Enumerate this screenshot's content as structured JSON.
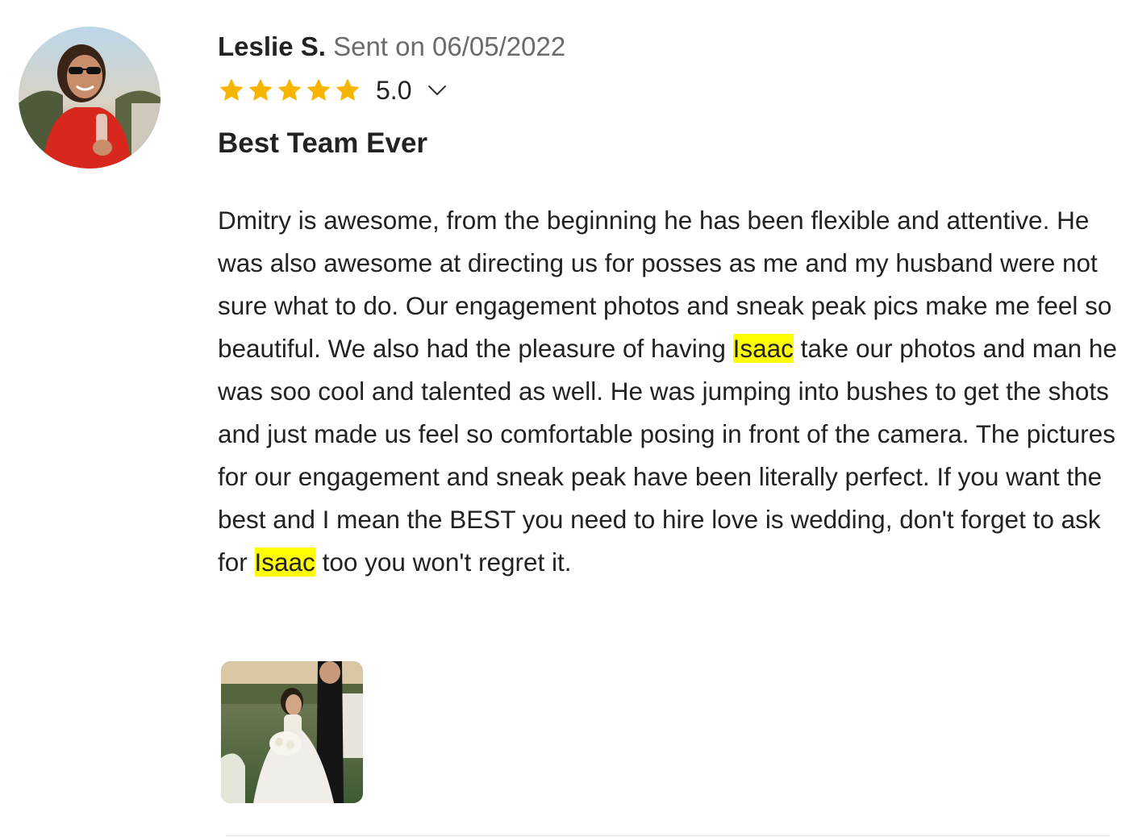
{
  "review": {
    "reviewer_name": "Leslie S.",
    "sent_on": "Sent on 06/05/2022",
    "rating_value": "5.0",
    "star_count": 5,
    "star_color": "#f7b500",
    "title": "Best Team Ever",
    "body_segments": [
      "Dmitry is awesome, from the beginning he has been flexible and attentive. He was also awesome at directing us for posses as me and my husband were not sure what to do. Our engagement photos and sneak peak pics make me feel so beautiful. We also had the pleasure of having ",
      "Isaac",
      " take our photos and man he was soo cool and talented as well. He was jumping into bushes to get the shots and just made us feel so comfortable posing in front of the camera. The pictures for our engagement and sneak peak have been literally perfect. If you want the best and I mean the BEST you need to hire love is wedding, don't forget to ask for ",
      "Isaac",
      " too you won't regret it."
    ],
    "highlight_color": "#ffff00",
    "icons": {
      "avatar": "reviewer-avatar-photo",
      "expand": "chevron-down-icon",
      "attachment": "wedding-photo-thumbnail"
    }
  }
}
